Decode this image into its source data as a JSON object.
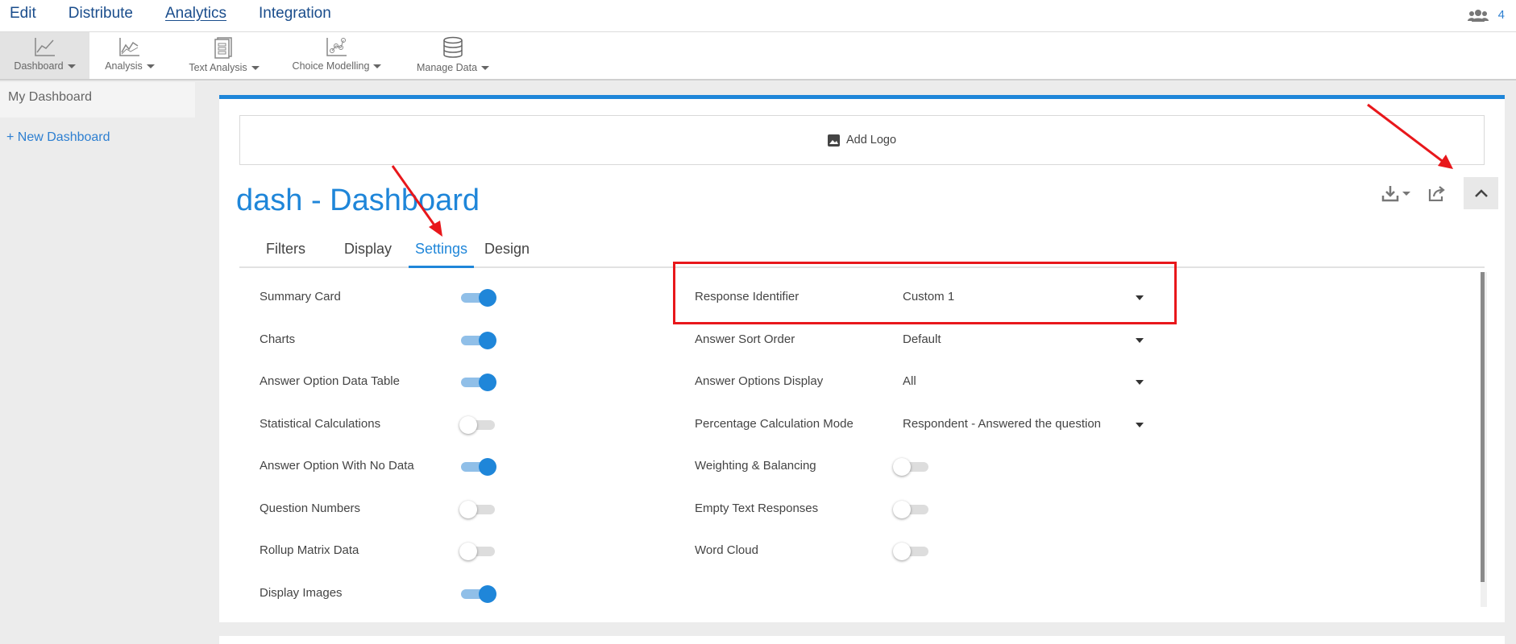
{
  "topmenu": {
    "items": [
      {
        "label": "Edit"
      },
      {
        "label": "Distribute"
      },
      {
        "label": "Analytics"
      },
      {
        "label": "Integration"
      }
    ],
    "active": "Analytics",
    "user_count": "4"
  },
  "ribbon": {
    "items": [
      {
        "label": "Dashboard",
        "icon": "line-chart-icon"
      },
      {
        "label": "Analysis",
        "icon": "analysis-chart-icon"
      },
      {
        "label": "Text Analysis",
        "icon": "text-analysis-icon"
      },
      {
        "label": "Choice Modelling",
        "icon": "scatter-chart-icon"
      },
      {
        "label": "Manage Data",
        "icon": "database-icon"
      }
    ],
    "active": "Dashboard"
  },
  "sidebar": {
    "title": "My Dashboard",
    "new_dashboard": "+ New Dashboard"
  },
  "main": {
    "add_logo": "Add Logo",
    "title": "dash - Dashboard",
    "tabs": [
      {
        "label": "Filters"
      },
      {
        "label": "Display"
      },
      {
        "label": "Settings"
      },
      {
        "label": "Design"
      }
    ],
    "active_tab": "Settings"
  },
  "settings_left": [
    {
      "label": "Summary Card",
      "on": true
    },
    {
      "label": "Charts",
      "on": true
    },
    {
      "label": "Answer Option Data Table",
      "on": true
    },
    {
      "label": "Statistical Calculations",
      "on": false
    },
    {
      "label": "Answer Option With No Data",
      "on": true
    },
    {
      "label": "Question Numbers",
      "on": false
    },
    {
      "label": "Rollup Matrix Data",
      "on": false
    },
    {
      "label": "Display Images",
      "on": true
    }
  ],
  "settings_right": [
    {
      "label": "Response Identifier",
      "value": "Custom 1"
    },
    {
      "label": "Answer Sort Order",
      "value": "Default"
    },
    {
      "label": "Answer Options Display",
      "value": "All"
    },
    {
      "label": "Percentage Calculation Mode",
      "value": "Respondent - Answered the question"
    },
    {
      "label": "Weighting & Balancing",
      "on": false
    },
    {
      "label": "Empty Text Responses",
      "on": false
    },
    {
      "label": "Word Cloud",
      "on": false
    }
  ],
  "colors": {
    "accent": "#1f86d9",
    "annotation": "#e8171b",
    "menu_text": "#1a4d8c"
  }
}
